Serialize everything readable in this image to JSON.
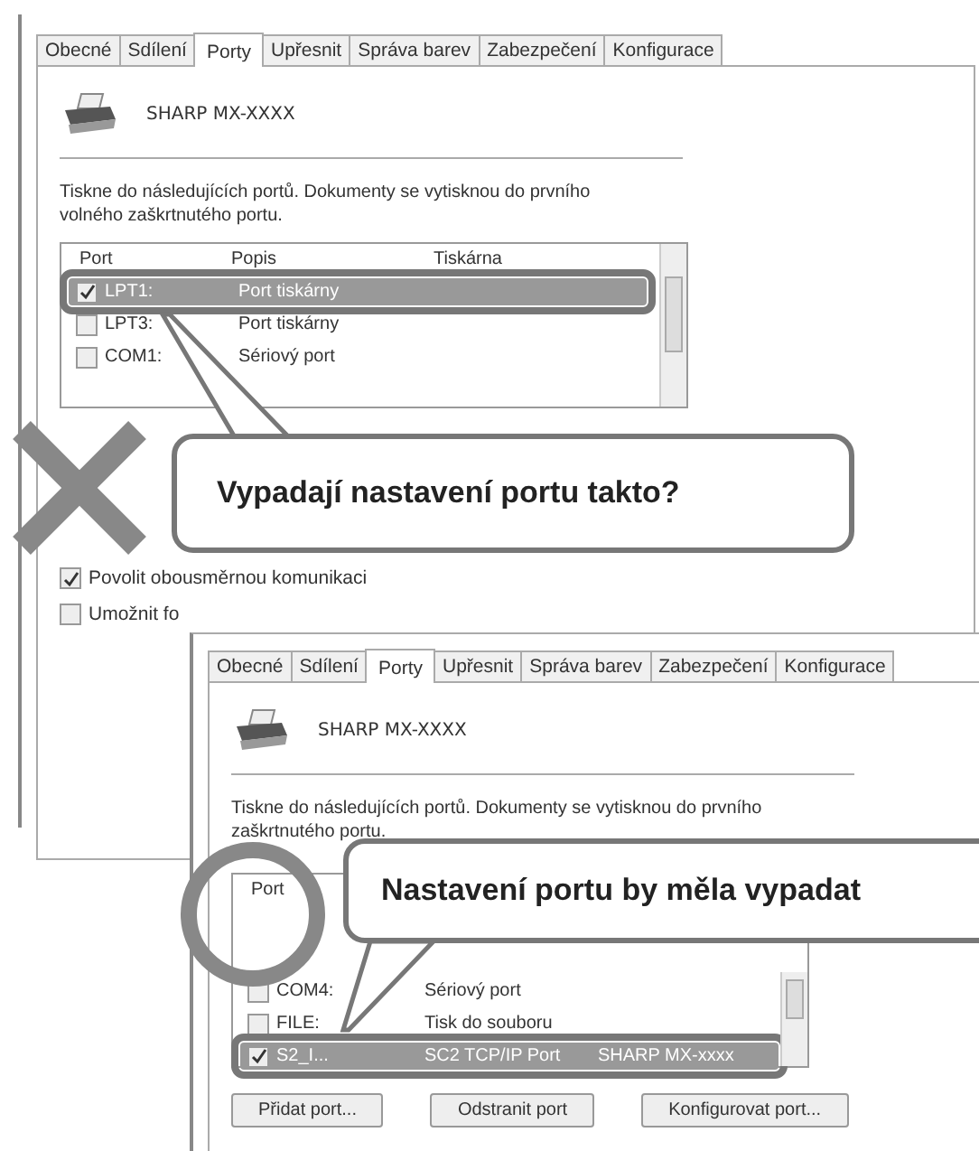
{
  "dialogs": [
    {
      "tabs": [
        {
          "label": "Obecné",
          "selected": false
        },
        {
          "label": "Sdílení",
          "selected": false
        },
        {
          "label": "Porty",
          "selected": true
        },
        {
          "label": "Upřesnit",
          "selected": false
        },
        {
          "label": "Správa barev",
          "selected": false
        },
        {
          "label": "Zabezpečení",
          "selected": false
        },
        {
          "label": "Konfigurace",
          "selected": false
        }
      ],
      "printer_name": "SHARP MX-XXXX",
      "description": "Tiskne do následujících portů. Dokumenty se vytisknou do prvního volného zaškrtnutého portu.",
      "columns": [
        "Port",
        "Popis",
        "Tiskárna"
      ],
      "rows": [
        {
          "port": "LPT1:",
          "description": "Port tiskárny",
          "checked": true,
          "selected": true
        },
        {
          "port": "LPT3:",
          "description": "Port tiskárny",
          "checked": false,
          "selected": false
        },
        {
          "port": "COM1:",
          "description": "Sériový port",
          "checked": false,
          "selected": false
        }
      ],
      "options": [
        {
          "label": "Povolit obousměrnou komunikaci",
          "checked": true
        },
        {
          "label": "Umožnit fo",
          "checked": false
        }
      ],
      "callout": "Vypadají nastavení portu takto?",
      "kind": "cross"
    },
    {
      "tabs": [
        {
          "label": "Obecné",
          "selected": false
        },
        {
          "label": "Sdílení",
          "selected": false
        },
        {
          "label": "Porty",
          "selected": true
        },
        {
          "label": "Upřesnit",
          "selected": false
        },
        {
          "label": "Správa barev",
          "selected": false
        },
        {
          "label": "Zabezpečení",
          "selected": false
        },
        {
          "label": "Konfigurace",
          "selected": false
        }
      ],
      "printer_name": "SHARP MX-XXXX",
      "description": "Tiskne do následujících portů. Dokumenty se vytisknou do prvního zaškrtnutého portu.",
      "columns": [
        "Port"
      ],
      "rows": [
        {
          "port": "COM4:",
          "description": "Sériový port",
          "checked": false,
          "selected": false
        },
        {
          "port": "FILE:",
          "description": "Tisk do souboru",
          "checked": false,
          "selected": false
        },
        {
          "port": "S2_I...",
          "description": "SC2 TCP/IP Port",
          "printer": "SHARP MX-xxxx",
          "checked": true,
          "selected": true
        }
      ],
      "buttons": [
        "Přidat port...",
        "Odstranit port",
        "Konfigurovat port..."
      ],
      "callout": "Nastavení portu by měla vypadat",
      "kind": "circle"
    }
  ]
}
